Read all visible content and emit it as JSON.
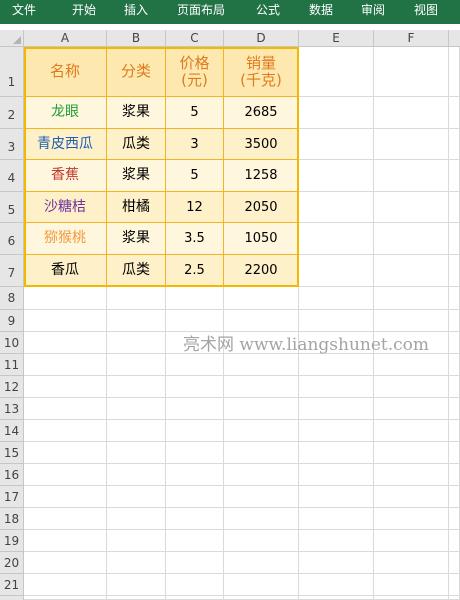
{
  "ribbon": {
    "tabs": [
      "文件",
      "开始",
      "插入",
      "页面布局",
      "公式",
      "数据",
      "审阅",
      "视图"
    ],
    "color": "#217346"
  },
  "columns": [
    "A",
    "B",
    "C",
    "D",
    "E",
    "F"
  ],
  "rows": [
    "1",
    "2",
    "3",
    "4",
    "5",
    "6",
    "7",
    "8",
    "9",
    "10",
    "11",
    "12",
    "13",
    "14",
    "15",
    "16",
    "17",
    "18",
    "19",
    "20",
    "21"
  ],
  "table": {
    "headers": [
      "名称",
      "分类",
      "价格\n(元)",
      "销量\n(千克)"
    ],
    "rows": [
      {
        "name": "龙眼",
        "name_color": "#1f9e3a",
        "category": "浆果",
        "price": "5",
        "sales": "2685"
      },
      {
        "name": "青皮西瓜",
        "name_color": "#1f5fb4",
        "category": "瓜类",
        "price": "3",
        "sales": "3500"
      },
      {
        "name": "香蕉",
        "name_color": "#c0392b",
        "category": "浆果",
        "price": "5",
        "sales": "1258"
      },
      {
        "name": "沙糖桔",
        "name_color": "#7030a0",
        "category": "柑橘",
        "price": "12",
        "sales": "2050"
      },
      {
        "name": "猕猴桃",
        "name_color": "#f29a3c",
        "category": "浆果",
        "price": "3.5",
        "sales": "1050"
      },
      {
        "name": "香瓜",
        "name_color": "#000000",
        "category": "瓜类",
        "price": "2.5",
        "sales": "2200"
      }
    ],
    "header_text_color": "#e07a1f",
    "border_color": "#f5b800",
    "header_fill": "#fde9b0",
    "band_fill_1": "#fef0c8",
    "band_fill_2": "#fff6de"
  },
  "watermark": "亮术网 www.liangshunet.com"
}
